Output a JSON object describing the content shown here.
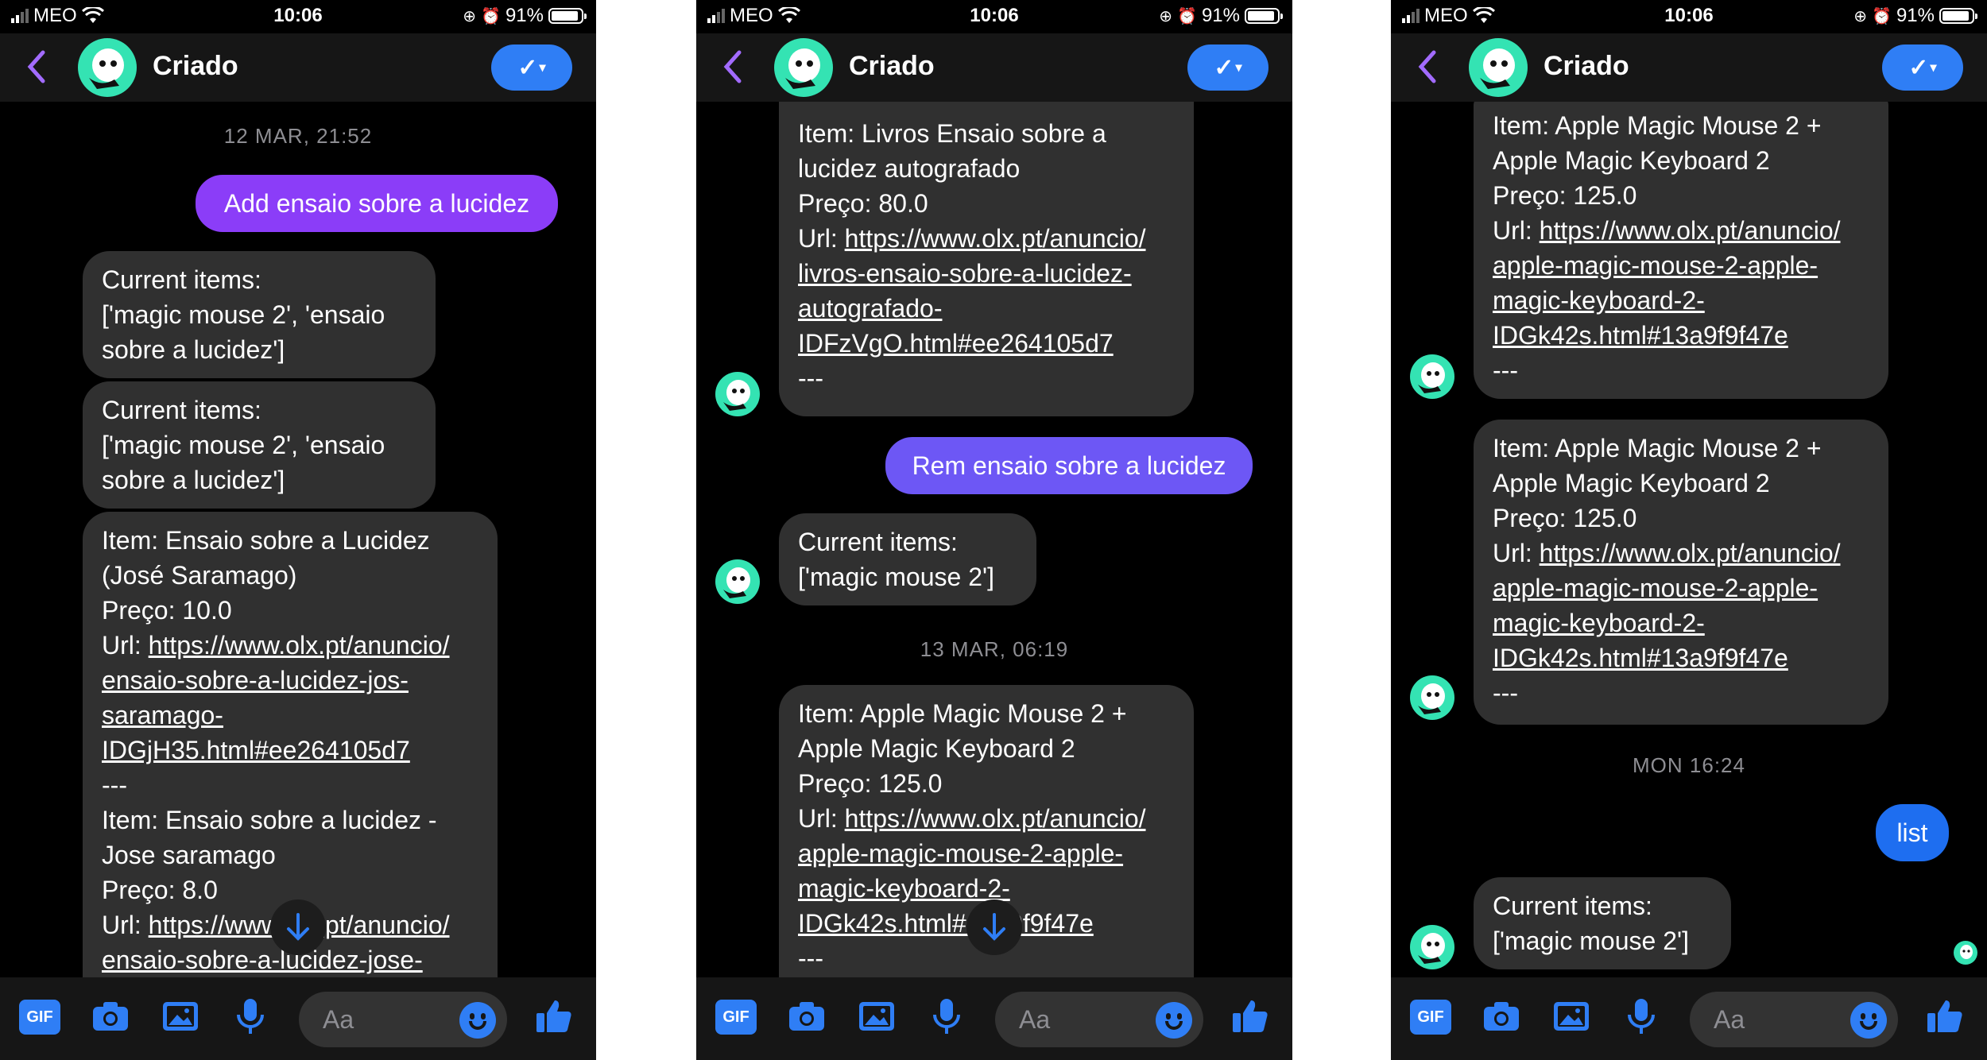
{
  "status": {
    "carrier": "MEO",
    "time": "10:06",
    "battery": "91%"
  },
  "header": {
    "name": "Criado"
  },
  "composer": {
    "placeholder": "Aa",
    "gif_label": "GIF"
  },
  "accent_colors": {
    "primary": "#2f7ef5",
    "avatar": "#34e3b3",
    "bubble_in": "#303030",
    "bubble_purple": "#8b3df8",
    "bubble_violet": "#6d57f5",
    "bubble_blue": "#1e6ef0"
  },
  "icons": [
    "back-chevron-icon",
    "checkmark-icon",
    "gif-icon",
    "camera-icon",
    "image-icon",
    "microphone-icon",
    "emoji-icon",
    "thumbs-up-icon",
    "arrow-down-icon"
  ],
  "screens": [
    {
      "messages": [
        {
          "kind": "stamp",
          "text": "12 MAR, 21:52"
        },
        {
          "kind": "out",
          "text": "Add ensaio sobre a lucidez"
        },
        {
          "kind": "in",
          "lines": [
            "Current items:",
            "['magic mouse 2', 'ensaio",
            "sobre a lucidez']"
          ]
        },
        {
          "kind": "in",
          "lines": [
            "Current items:",
            "['magic mouse 2', 'ensaio",
            "sobre a lucidez']"
          ]
        },
        {
          "kind": "in",
          "lines": [
            "Item: Ensaio sobre a Lucidez",
            "(José Saramago)",
            "Preço: 10.0",
            "Url: "
          ],
          "link": [
            "https://www.olx.pt/anuncio/",
            "ensaio-sobre-a-lucidez-jos-",
            "saramago-",
            "IDGjH35.html#ee264105d7"
          ],
          "after": [
            "---",
            "Item: Ensaio sobre a lucidez -",
            "Jose saramago",
            "Preço: 8.0",
            "Url: "
          ],
          "link2": [
            "https://www.olx.pt/anuncio/",
            "ensaio-sobre-a-lucidez-jose-"
          ]
        }
      ]
    },
    {
      "messages": [
        {
          "kind": "in",
          "lines": [
            "---",
            "Item: Livros Ensaio sobre a",
            "lucidez autografado",
            "Preço: 80.0",
            "Url: "
          ],
          "link": [
            "https://www.olx.pt/anuncio/",
            "livros-ensaio-sobre-a-lucidez-",
            "autografado-",
            "IDFzVgO.html#ee264105d7"
          ],
          "after": [
            "---"
          ]
        },
        {
          "kind": "out",
          "text": "Rem ensaio sobre a lucidez"
        },
        {
          "kind": "in",
          "lines": [
            "Current items:",
            "['magic mouse 2']"
          ]
        },
        {
          "kind": "stamp",
          "text": "13 MAR, 06:19"
        },
        {
          "kind": "in",
          "lines": [
            "Item: Apple Magic Mouse 2 +",
            "Apple Magic Keyboard 2",
            "Preço: 125.0",
            "Url: "
          ],
          "link": [
            "https://www.olx.pt/anuncio/",
            "apple-magic-mouse-2-apple-",
            "magic-keyboard-2-",
            "IDGk42s.html#13a9f9f47e"
          ],
          "after": [
            "---"
          ]
        }
      ]
    },
    {
      "messages": [
        {
          "kind": "in",
          "lines": [
            "Item: Apple Magic Mouse 2 +",
            "Apple Magic Keyboard 2",
            "Preço: 125.0",
            "Url: "
          ],
          "link": [
            "https://www.olx.pt/anuncio/",
            "apple-magic-mouse-2-apple-",
            "magic-keyboard-2-",
            "IDGk42s.html#13a9f9f47e"
          ],
          "after": [
            "---"
          ]
        },
        {
          "kind": "in",
          "lines": [
            "Item: Apple Magic Mouse 2 +",
            "Apple Magic Keyboard 2",
            "Preço: 125.0",
            "Url: "
          ],
          "link": [
            "https://www.olx.pt/anuncio/",
            "apple-magic-mouse-2-apple-",
            "magic-keyboard-2-",
            "IDGk42s.html#13a9f9f47e"
          ],
          "after": [
            "---"
          ]
        },
        {
          "kind": "stamp",
          "text": "MON 16:24"
        },
        {
          "kind": "out",
          "text": "list"
        },
        {
          "kind": "in",
          "lines": [
            "Current items:",
            "['magic mouse 2']"
          ]
        }
      ]
    }
  ]
}
